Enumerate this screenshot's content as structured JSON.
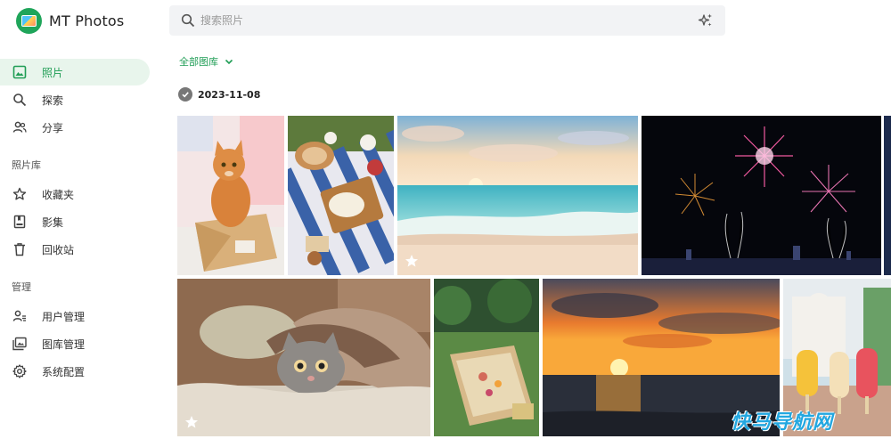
{
  "app": {
    "name": "MT Photos"
  },
  "search": {
    "placeholder": "搜索照片",
    "value": ""
  },
  "sidebar": {
    "items": [
      {
        "label": "照片",
        "icon": "photo-icon",
        "active": true
      },
      {
        "label": "探索",
        "icon": "search-icon",
        "active": false
      },
      {
        "label": "分享",
        "icon": "people-icon",
        "active": false
      }
    ],
    "library_title": "照片库",
    "library_items": [
      {
        "label": "收藏夹",
        "icon": "star-icon"
      },
      {
        "label": "影集",
        "icon": "album-icon"
      },
      {
        "label": "回收站",
        "icon": "trash-icon"
      }
    ],
    "manage_title": "管理",
    "manage_items": [
      {
        "label": "用户管理",
        "icon": "user-manage-icon"
      },
      {
        "label": "图库管理",
        "icon": "gallery-icon"
      },
      {
        "label": "系统配置",
        "icon": "gear-icon"
      }
    ]
  },
  "main": {
    "filter_label": "全部图库",
    "date_label": "2023-11-08",
    "photos": [
      {
        "name": "cat-in-box",
        "favorite": false
      },
      {
        "name": "picnic-blanket",
        "favorite": false
      },
      {
        "name": "beach-sunset",
        "favorite": true
      },
      {
        "name": "fireworks",
        "favorite": false
      },
      {
        "name": "cat-under-blanket",
        "favorite": true
      },
      {
        "name": "garden-picnic",
        "favorite": false
      },
      {
        "name": "sea-sunset",
        "favorite": false
      },
      {
        "name": "popsicles",
        "favorite": false
      }
    ]
  },
  "watermark": "快马导航网",
  "colors": {
    "accent": "#1f9d55",
    "active_bg": "#e8f5ec",
    "search_bg": "#f2f3f5"
  }
}
